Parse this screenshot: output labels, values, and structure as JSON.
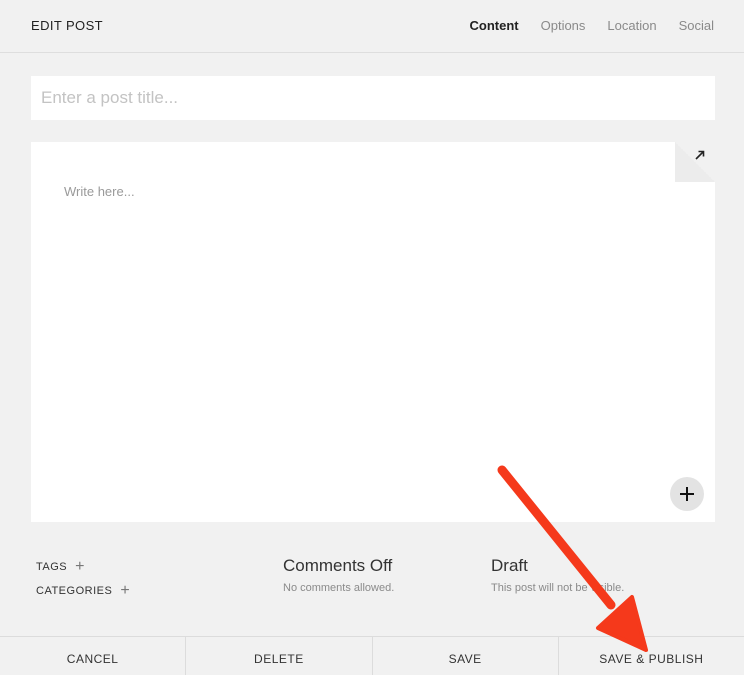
{
  "header": {
    "title": "EDIT POST",
    "tabs": [
      {
        "label": "Content",
        "active": true
      },
      {
        "label": "Options",
        "active": false
      },
      {
        "label": "Location",
        "active": false
      },
      {
        "label": "Social",
        "active": false
      }
    ]
  },
  "editor": {
    "title_placeholder": "Enter a post title...",
    "body_placeholder": "Write here..."
  },
  "meta": {
    "tags_label": "TAGS",
    "categories_label": "CATEGORIES",
    "plus_glyph": "+"
  },
  "comments": {
    "title": "Comments Off",
    "description": "No comments allowed."
  },
  "status": {
    "title": "Draft",
    "description": "This post will not be visible."
  },
  "footer": {
    "cancel_label": "CANCEL",
    "delete_label": "DELETE",
    "save_label": "SAVE",
    "save_publish_label": "SAVE & PUBLISH"
  },
  "colors": {
    "annotation_arrow": "#f5391b"
  },
  "icons": {
    "expand": "expand-arrow-icon",
    "add": "plus-icon"
  }
}
